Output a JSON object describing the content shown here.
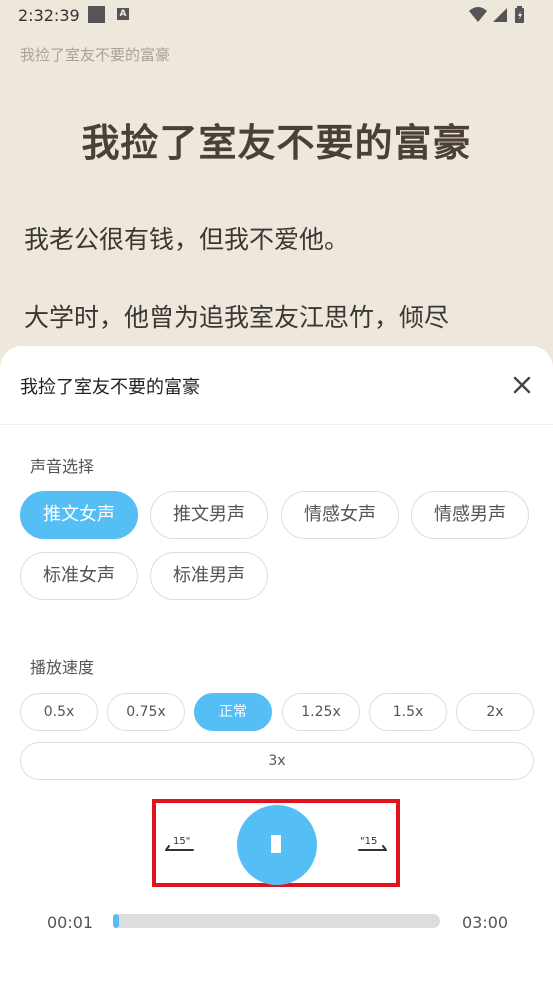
{
  "status": {
    "time": "2:32:39"
  },
  "reader": {
    "book_header": "我捡了室友不要的富豪",
    "chapter_title": "我捡了室友不要的富豪",
    "paragraphs": [
      "我老公很有钱，但我不爱他。",
      "大学时，他曾为追我室友江思竹，倾尽"
    ]
  },
  "sheet": {
    "title": "我捡了室友不要的富豪",
    "voice_label": "声音选择",
    "voices": [
      "推文女声",
      "推文男声",
      "情感女声",
      "情感男声",
      "标准女声",
      "标准男声"
    ],
    "selected_voice": "推文女声",
    "speed_label": "播放速度",
    "speeds": [
      "0.5x",
      "0.75x",
      "正常",
      "1.25x",
      "1.5x",
      "2x",
      "3x"
    ],
    "selected_speed": "正常",
    "rewind_label": "15\"",
    "forward_label": "\"15",
    "current_time": "00:01",
    "total_time": "03:00",
    "progress": 0.006
  },
  "colors": {
    "accent": "#55bff5",
    "highlight": "#e0141e",
    "reader_bg": "#ede7dc"
  }
}
